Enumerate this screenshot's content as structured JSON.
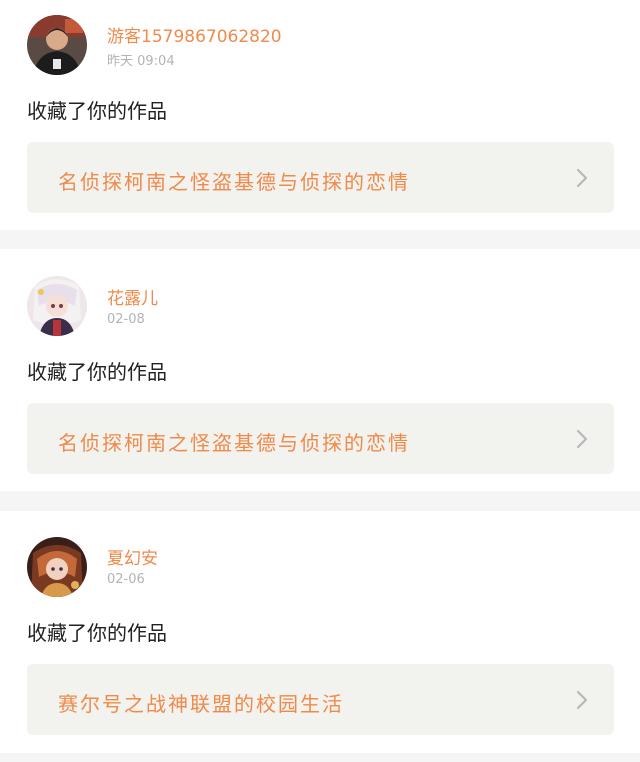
{
  "notifications": [
    {
      "username": "游客1579867062820",
      "time": "昨天 09:04",
      "action": "收藏了你的作品",
      "work_title": "名侦探柯南之怪盗基德与侦探的恋情"
    },
    {
      "username": "花露儿",
      "time": "02-08",
      "action": "收藏了你的作品",
      "work_title": "名侦探柯南之怪盗基德与侦探的恋情"
    },
    {
      "username": "夏幻安",
      "time": "02-06",
      "action": "收藏了你的作品",
      "work_title": "赛尔号之战神联盟的校园生活"
    }
  ],
  "colors": {
    "accent": "#f08a4b",
    "timestamp": "#b3b3b3",
    "card_bg": "#ffffff",
    "link_bg": "#f2f2ee",
    "page_bg": "#f5f5f5"
  },
  "icons": {
    "chevron": "chevron-right-icon",
    "avatar": "user-avatar"
  }
}
